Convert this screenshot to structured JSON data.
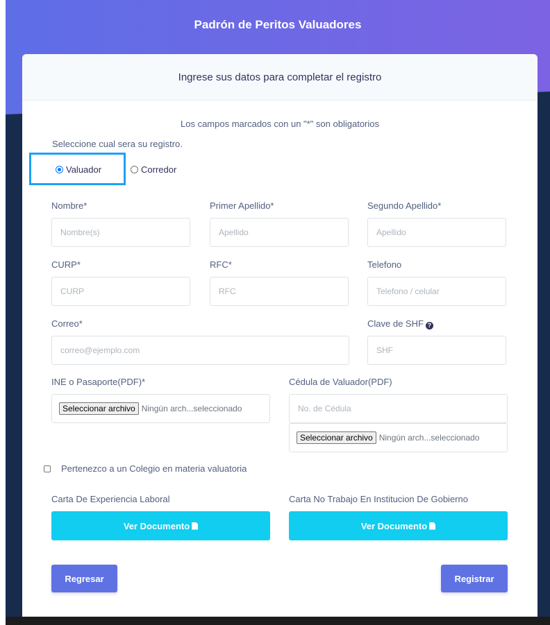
{
  "header": {
    "title": "Padrón de Peritos Valuadores"
  },
  "card": {
    "subtitle": "Ingrese sus datos para completar el registro",
    "required_note": "Los campos marcados con un \"*\" son obligatorios",
    "select_prompt": "Seleccione cual sera su registro.",
    "radio_options": [
      {
        "label": "Valuador",
        "checked": true
      },
      {
        "label": "Corredor",
        "checked": false
      }
    ]
  },
  "fields": {
    "nombre": {
      "label": "Nombre*",
      "placeholder": "Nombre(s)"
    },
    "primer_apellido": {
      "label": "Primer Apellido*",
      "placeholder": "Apellido"
    },
    "segundo_apellido": {
      "label": "Segundo Apellido*",
      "placeholder": "Apellido"
    },
    "curp": {
      "label": "CURP*",
      "placeholder": "CURP"
    },
    "rfc": {
      "label": "RFC*",
      "placeholder": "RFC"
    },
    "telefono": {
      "label": "Telefono",
      "placeholder": "Telefono / celular"
    },
    "correo": {
      "label": "Correo*",
      "placeholder": "correo@ejemplo.com"
    },
    "clave_shf": {
      "label": "Clave de SHF",
      "placeholder": "SHF",
      "help_glyph": "?"
    },
    "ine": {
      "label": "INE o Pasaporte(PDF)*",
      "button": "Seleccionar archivo",
      "status": "Ningún arch...seleccionado"
    },
    "cedula": {
      "label": "Cédula de Valuador(PDF)",
      "placeholder": "No. de Cédula",
      "button": "Seleccionar archivo",
      "status": "Ningún arch...seleccionado"
    }
  },
  "colegio": {
    "label": "Pertenezco a un Colegio en materia valuatoria",
    "checked": false
  },
  "documents": {
    "experiencia": {
      "label": "Carta De Experiencia Laboral",
      "button": "Ver Documento"
    },
    "no_trabajo": {
      "label": "Carta No Trabajo En Institucion De Gobierno",
      "button": "Ver Documento"
    }
  },
  "actions": {
    "back": "Regresar",
    "submit": "Registrar"
  },
  "colors": {
    "gradient_start": "#5e6ee6",
    "gradient_end": "#7c63e4",
    "dark_bg": "#172b4d",
    "info": "#11cdef",
    "primary": "#5e72e4",
    "highlight": "#1da1f2"
  }
}
